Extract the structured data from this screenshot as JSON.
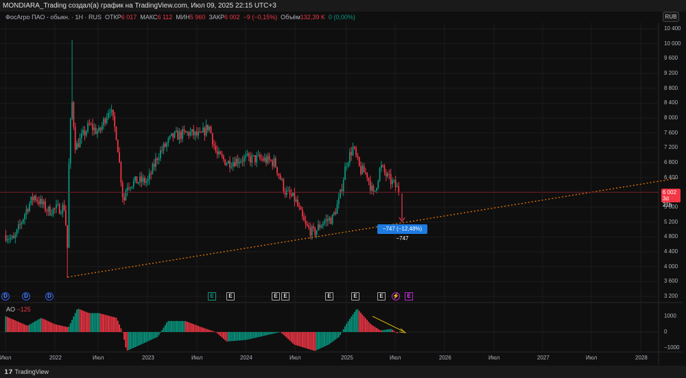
{
  "title": "MONDIARA_Trading создал(а) график на TradingView.com, Июл 09, 2025 22:15 UTC+3",
  "legend": {
    "symbol": "ФосАгро ПАО - обыкн. · 1H · RUS",
    "open_label": "ОТКР",
    "open": "6 017",
    "high_label": "МАКС",
    "high": "6 112",
    "low_label": "МИН",
    "low": "5 960",
    "close_label": "ЗАКР",
    "close": "6 002",
    "change": "−9 (−0,15%)",
    "volume_label": "Объём",
    "volume": "132,39 K",
    "vol_change": "0 (0,00%)"
  },
  "currency": "RUB",
  "price_axis": [
    "10 400",
    "10 000",
    "9 600",
    "9 200",
    "8 800",
    "8 400",
    "8 000",
    "7 600",
    "7 200",
    "6 800",
    "6 400",
    "5 600",
    "5 200",
    "4 800",
    "4 400",
    "4 000",
    "3 600",
    "3 200"
  ],
  "price_tag": {
    "price": "6 002",
    "countdown": "3d 21h",
    "value": 6002
  },
  "measure_label": "−747 (−12,48%) −747",
  "ao": {
    "label": "AO",
    "value": "−125",
    "axis": [
      "1000",
      "0",
      "−1000"
    ]
  },
  "time_axis": [
    "Июл",
    "2022",
    "Июл",
    "2023",
    "Июл",
    "2024",
    "Июл",
    "2025",
    "Июл",
    "2026",
    "Июл",
    "2027",
    "Июл",
    "2028"
  ],
  "markers": [
    {
      "type": "D",
      "label": "D"
    },
    {
      "type": "D",
      "label": "D"
    },
    {
      "type": "D",
      "label": "D"
    },
    {
      "type": "Eg",
      "label": "E"
    },
    {
      "type": "E",
      "label": "E"
    },
    {
      "type": "E",
      "label": "E"
    },
    {
      "type": "E",
      "label": "E"
    },
    {
      "type": "E",
      "label": "E"
    },
    {
      "type": "E",
      "label": "E"
    },
    {
      "type": "E",
      "label": "E"
    },
    {
      "type": "S",
      "label": "⚡"
    },
    {
      "type": "Ep",
      "label": "E"
    }
  ],
  "footer": {
    "logo": "17",
    "brand": "TradingView"
  },
  "colors": {
    "up": "#089981",
    "down": "#f23645",
    "trend": "#f57c00",
    "measure": "#1e7be0"
  },
  "chart_data": {
    "type": "candlestick",
    "price_range": [
      3200,
      10400
    ],
    "price_path": [
      [
        2021.5,
        4850
      ],
      [
        2021.58,
        4700
      ],
      [
        2021.72,
        5600
      ],
      [
        2021.79,
        5900
      ],
      [
        2021.93,
        5500
      ],
      [
        2022.1,
        5600
      ],
      [
        2022.13,
        4400
      ],
      [
        2022.14,
        6500
      ],
      [
        2022.17,
        8600
      ],
      [
        2022.21,
        7200
      ],
      [
        2022.35,
        7800
      ],
      [
        2022.45,
        7600
      ],
      [
        2022.56,
        8300
      ],
      [
        2022.63,
        7500
      ],
      [
        2022.7,
        5700
      ],
      [
        2022.73,
        6200
      ],
      [
        2022.84,
        6300
      ],
      [
        2022.95,
        6300
      ],
      [
        2023.05,
        7000
      ],
      [
        2023.2,
        7500
      ],
      [
        2023.37,
        7600
      ],
      [
        2023.48,
        7500
      ],
      [
        2023.57,
        7800
      ],
      [
        2023.65,
        7000
      ],
      [
        2023.76,
        6800
      ],
      [
        2023.9,
        6900
      ],
      [
        2024.1,
        6900
      ],
      [
        2024.24,
        6800
      ],
      [
        2024.35,
        6000
      ],
      [
        2024.45,
        5800
      ],
      [
        2024.55,
        5100
      ],
      [
        2024.64,
        4900
      ],
      [
        2024.73,
        5200
      ],
      [
        2024.83,
        5300
      ],
      [
        2024.9,
        5800
      ],
      [
        2024.97,
        6800
      ],
      [
        2025.04,
        7200
      ],
      [
        2025.11,
        6600
      ],
      [
        2025.18,
        6500
      ],
      [
        2025.25,
        5900
      ],
      [
        2025.32,
        6700
      ],
      [
        2025.39,
        6400
      ],
      [
        2025.46,
        6200
      ],
      [
        2025.52,
        6002
      ]
    ],
    "spikes": [
      {
        "t": 2022.13,
        "low": 3700
      },
      {
        "t": 2022.17,
        "high": 10100
      }
    ],
    "trendline": [
      [
        2022.13,
        3720
      ],
      [
        2028.35,
        6380
      ]
    ],
    "ao_path": [
      [
        2021.5,
        1000
      ],
      [
        2021.72,
        400
      ],
      [
        2021.86,
        900
      ],
      [
        2022.0,
        500
      ],
      [
        2022.14,
        300
      ],
      [
        2022.23,
        1500
      ],
      [
        2022.35,
        1200
      ],
      [
        2022.45,
        1200
      ],
      [
        2022.63,
        900
      ],
      [
        2022.69,
        0
      ],
      [
        2022.73,
        -1200
      ],
      [
        2022.84,
        -900
      ],
      [
        2023.05,
        -300
      ],
      [
        2023.15,
        700
      ],
      [
        2023.33,
        700
      ],
      [
        2023.5,
        300
      ],
      [
        2023.64,
        0
      ],
      [
        2023.75,
        -600
      ],
      [
        2023.95,
        -500
      ],
      [
        2024.16,
        -200
      ],
      [
        2024.3,
        0
      ],
      [
        2024.44,
        -800
      ],
      [
        2024.65,
        -1200
      ],
      [
        2024.79,
        -800
      ],
      [
        2024.9,
        -300
      ],
      [
        2024.97,
        500
      ],
      [
        2025.08,
        1500
      ],
      [
        2025.22,
        500
      ],
      [
        2025.32,
        100
      ],
      [
        2025.43,
        200
      ],
      [
        2025.5,
        -125
      ]
    ]
  }
}
